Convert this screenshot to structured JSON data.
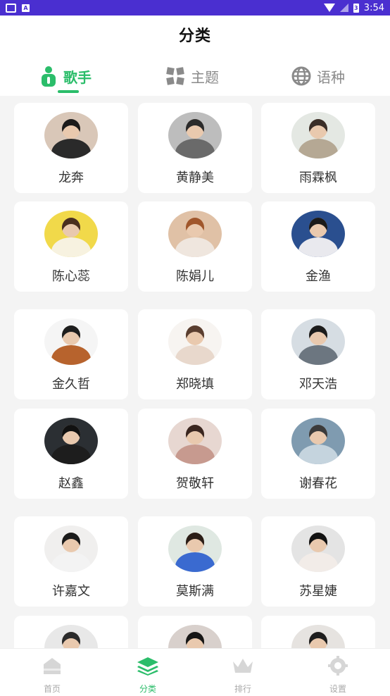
{
  "status_bar": {
    "time": "3:54",
    "battery_label": "3",
    "app_icon_label": "A"
  },
  "header": {
    "title": "分类"
  },
  "tabs": [
    {
      "label": "歌手",
      "icon": "singer-icon",
      "active": true
    },
    {
      "label": "主题",
      "icon": "theme-icon",
      "active": false
    },
    {
      "label": "语种",
      "icon": "globe-icon",
      "active": false
    }
  ],
  "singers": [
    {
      "name": "龙奔",
      "avatar_bg": "#d9c7b8",
      "hair": "#1b1b1b",
      "shirt": "#2a2a2a"
    },
    {
      "name": "黄静美",
      "avatar_bg": "#bdbdbd",
      "hair": "#2b2b2b",
      "shirt": "#6a6a6a"
    },
    {
      "name": "雨霖枫",
      "avatar_bg": "#e4e8e3",
      "hair": "#3a2e28",
      "shirt": "#b5a894"
    },
    {
      "name": "陈心蕊",
      "avatar_bg": "#f1d94a",
      "hair": "#4a2f1f",
      "shirt": "#f7f2e0"
    },
    {
      "name": "陈娟儿",
      "avatar_bg": "#e0c1a6",
      "hair": "#a0562b",
      "shirt": "#efe6de"
    },
    {
      "name": "金渔",
      "avatar_bg": "#2a4f8f",
      "hair": "#1a1a1a",
      "shirt": "#e9e9ee"
    },
    {
      "name": "金久哲",
      "avatar_bg": "#f5f5f5",
      "hair": "#1e1e1e",
      "shirt": "#b7632d"
    },
    {
      "name": "郑晓填",
      "avatar_bg": "#f7f4f1",
      "hair": "#5a3e30",
      "shirt": "#e8d8cc"
    },
    {
      "name": "邓天浩",
      "avatar_bg": "#d6dde3",
      "hair": "#1c1c1c",
      "shirt": "#6c7680"
    },
    {
      "name": "赵鑫",
      "avatar_bg": "#2b2f33",
      "hair": "#111111",
      "shirt": "#1d1d1d"
    },
    {
      "name": "贺敬轩",
      "avatar_bg": "#e7d7d1",
      "hair": "#3a2620",
      "shirt": "#c79a8f"
    },
    {
      "name": "谢春花",
      "avatar_bg": "#7f9bb0",
      "hair": "#3b3b3b",
      "shirt": "#c5d4de"
    },
    {
      "name": "许嘉文",
      "avatar_bg": "#f0efee",
      "hair": "#1b1b1b",
      "shirt": "#f3f3f3"
    },
    {
      "name": "莫斯满",
      "avatar_bg": "#dfe8e2",
      "hair": "#2a1e17",
      "shirt": "#3a6ad0"
    },
    {
      "name": "苏星婕",
      "avatar_bg": "#e4e4e4",
      "hair": "#121212",
      "shirt": "#f2ece8"
    },
    {
      "name": "",
      "avatar_bg": "#e8e8e8",
      "hair": "#2b2b2b",
      "shirt": "#cfcfcf"
    },
    {
      "name": "",
      "avatar_bg": "#d8d0cc",
      "hair": "#161616",
      "shirt": "#cfcfcf"
    },
    {
      "name": "",
      "avatar_bg": "#e6e3e0",
      "hair": "#1e1e1e",
      "shirt": "#cfcfcf"
    }
  ],
  "bottom_nav": [
    {
      "label": "首页",
      "icon": "home-icon",
      "active": false
    },
    {
      "label": "分类",
      "icon": "layers-icon",
      "active": true
    },
    {
      "label": "排行",
      "icon": "crown-icon",
      "active": false
    },
    {
      "label": "设置",
      "icon": "gear-icon",
      "active": false
    }
  ],
  "colors": {
    "accent": "#2bbd6a",
    "status_bar": "#4a2fd0",
    "grid_bg": "#f4f4f4"
  }
}
